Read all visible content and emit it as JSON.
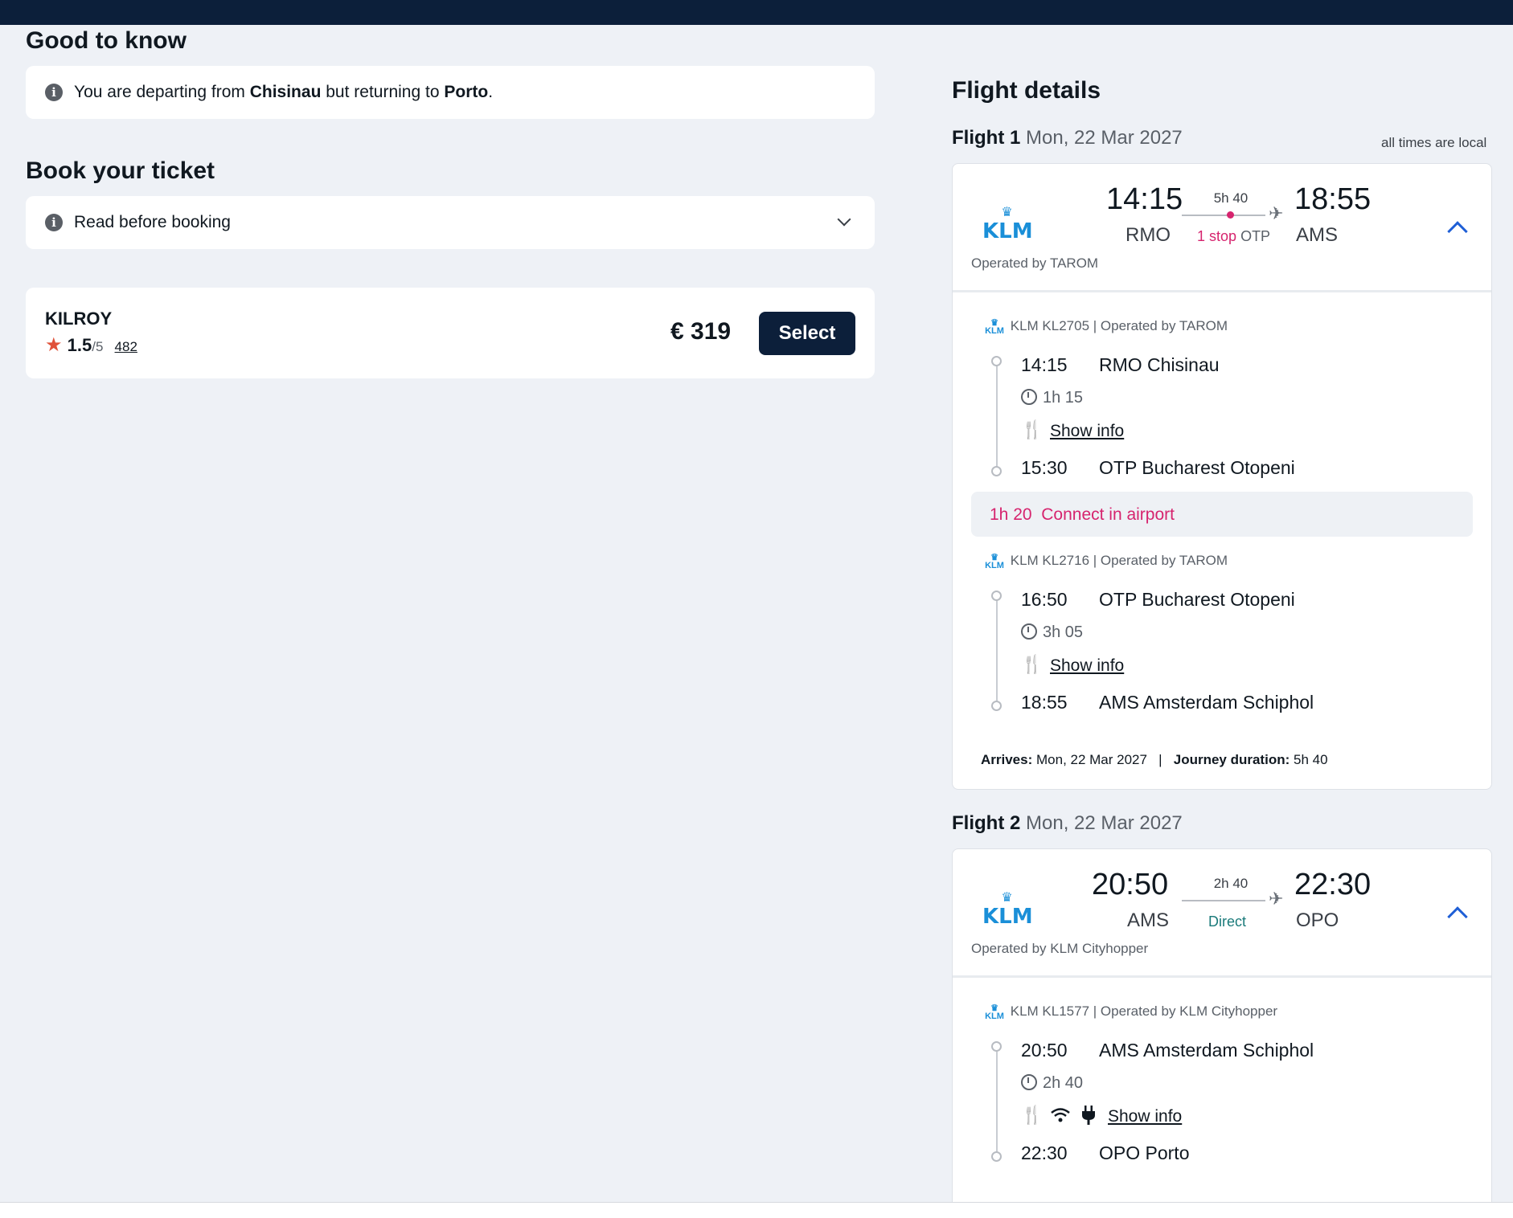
{
  "good_to_know": {
    "heading": "Good to know",
    "msg_prefix": "You are departing from",
    "from_city": "Chisinau",
    "msg_middle": "but returning to",
    "to_city": "Porto",
    "msg_suffix": "."
  },
  "book": {
    "heading": "Book your ticket",
    "read_before": "Read before booking"
  },
  "offer": {
    "provider": "KILROY",
    "rating": "1.5",
    "rating_max": "/5",
    "reviews": "482",
    "price": "€ 319",
    "select_label": "Select"
  },
  "details": {
    "heading": "Flight details",
    "times_note": "all times are local"
  },
  "flight1": {
    "label": "Flight 1",
    "date": "Mon, 22 Mar 2027",
    "airline": "KLM",
    "dep_time": "14:15",
    "dep_code": "RMO",
    "duration": "5h 40",
    "stops": "1 stop",
    "stop_code": "OTP",
    "arr_time": "18:55",
    "arr_code": "AMS",
    "operated": "Operated by TAROM",
    "segments": [
      {
        "title": "KLM KL2705 | Operated by TAROM",
        "dep_time": "14:15",
        "dep_place": "RMO Chisinau",
        "duration": "1h 15",
        "show_info": "Show info",
        "arr_time": "15:30",
        "arr_place": "OTP Bucharest Otopeni"
      },
      {
        "title": "KLM KL2716 | Operated by TAROM",
        "dep_time": "16:50",
        "dep_place": "OTP Bucharest Otopeni",
        "duration": "3h 05",
        "show_info": "Show info",
        "arr_time": "18:55",
        "arr_place": "AMS Amsterdam Schiphol"
      }
    ],
    "connect_time": "1h 20",
    "connect_text": "Connect in airport",
    "arrives_label": "Arrives:",
    "arrives_value": "Mon, 22 Mar 2027",
    "separator": "|",
    "journey_label": "Journey duration:",
    "journey_value": "5h 40"
  },
  "flight2": {
    "label": "Flight 2",
    "date": "Mon, 22 Mar 2027",
    "airline": "KLM",
    "dep_time": "20:50",
    "dep_code": "AMS",
    "duration": "2h 40",
    "stops": "Direct",
    "arr_time": "22:30",
    "arr_code": "OPO",
    "operated": "Operated by KLM Cityhopper",
    "segment": {
      "title": "KLM KL1577 | Operated by KLM Cityhopper",
      "dep_time": "20:50",
      "dep_place": "AMS Amsterdam Schiphol",
      "duration": "2h 40",
      "show_info": "Show info",
      "arr_time": "22:30",
      "arr_place": "OPO Porto"
    }
  },
  "icons": {
    "meal": "🍴",
    "wifi": "wifi",
    "power": "power-plug",
    "plane": "✈",
    "crown": "♛"
  }
}
